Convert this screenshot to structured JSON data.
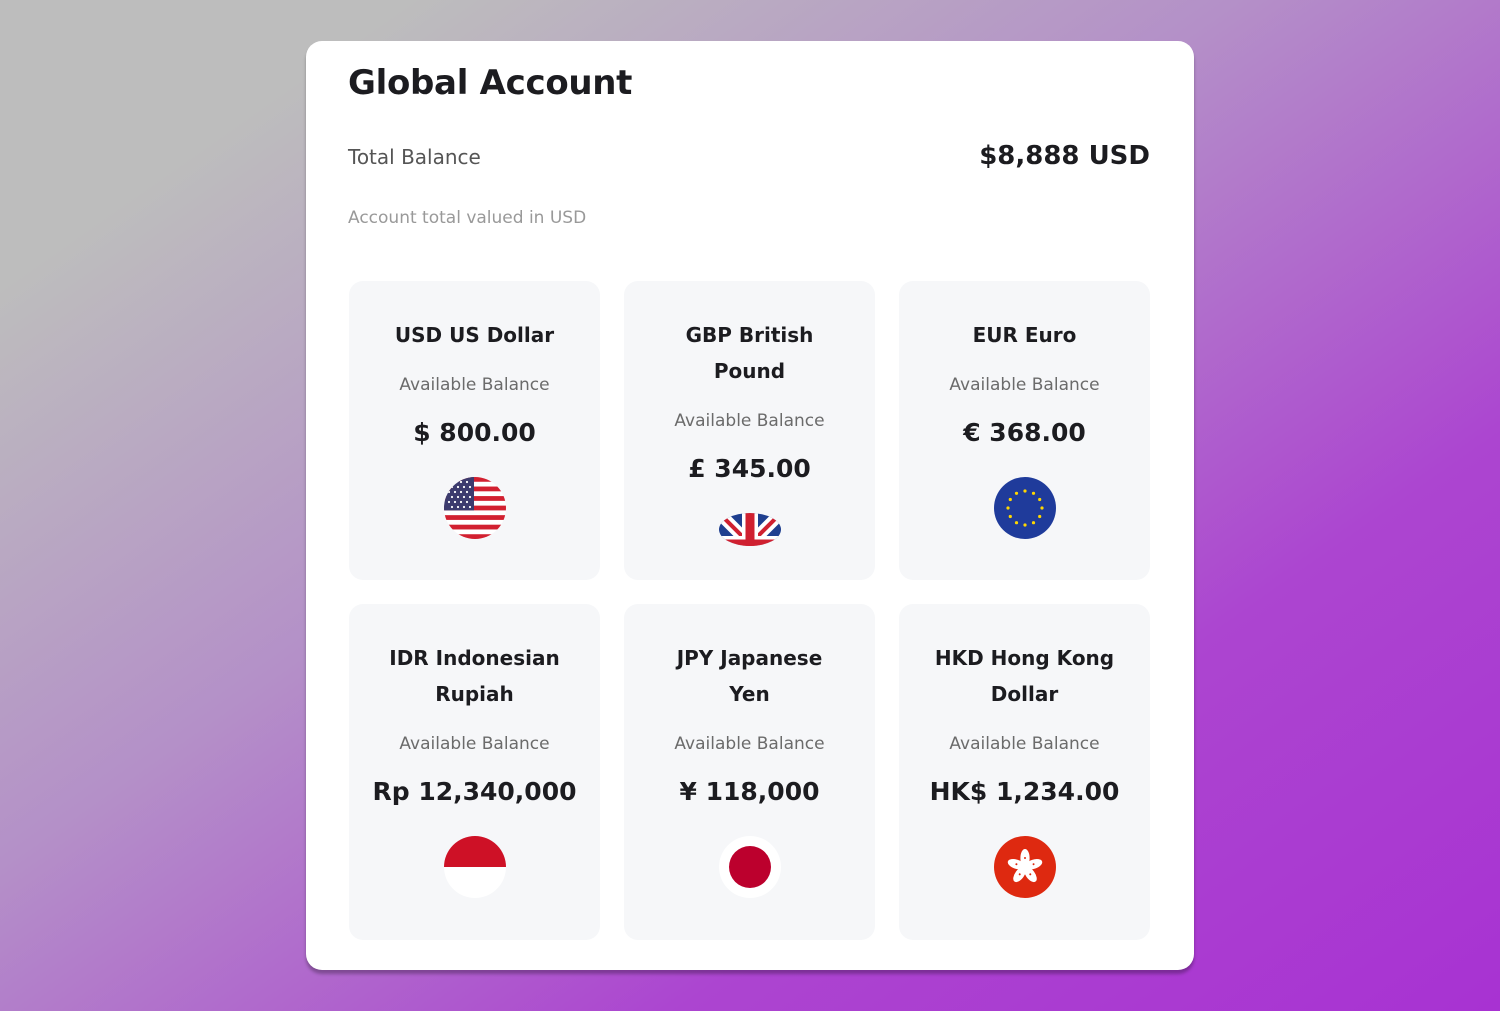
{
  "header": {
    "title": "Global Account",
    "total_label": "Total Balance",
    "total_amount": "$8,888 USD",
    "total_note": "Account total valued in USD"
  },
  "accounts": [
    {
      "name": "USD US Dollar",
      "balance_label": "Available Balance",
      "amount": "$ 800.00",
      "flag_icon": "us-flag-icon"
    },
    {
      "name": "GBP British Pound",
      "balance_label": "Available Balance",
      "amount": "£ 345.00",
      "flag_icon": "uk-flag-icon"
    },
    {
      "name": "EUR Euro",
      "balance_label": "Available Balance",
      "amount": "€ 368.00",
      "flag_icon": "eu-flag-icon"
    },
    {
      "name": "IDR Indonesian Rupiah",
      "balance_label": "Available Balance",
      "amount": "Rp 12,340,000",
      "flag_icon": "indonesia-flag-icon"
    },
    {
      "name": "JPY Japanese Yen",
      "balance_label": "Available Balance",
      "amount": "¥ 118,000",
      "flag_icon": "japan-flag-icon"
    },
    {
      "name": "HKD Hong Kong Dollar",
      "balance_label": "Available Balance",
      "amount": "HK$ 1,234.00",
      "flag_icon": "hong-kong-flag-icon"
    }
  ],
  "colors": {
    "background_start": "#bdbdbd",
    "background_end": "#a832d2",
    "card_background": "#f6f7f9",
    "panel_background": "#ffffff"
  }
}
